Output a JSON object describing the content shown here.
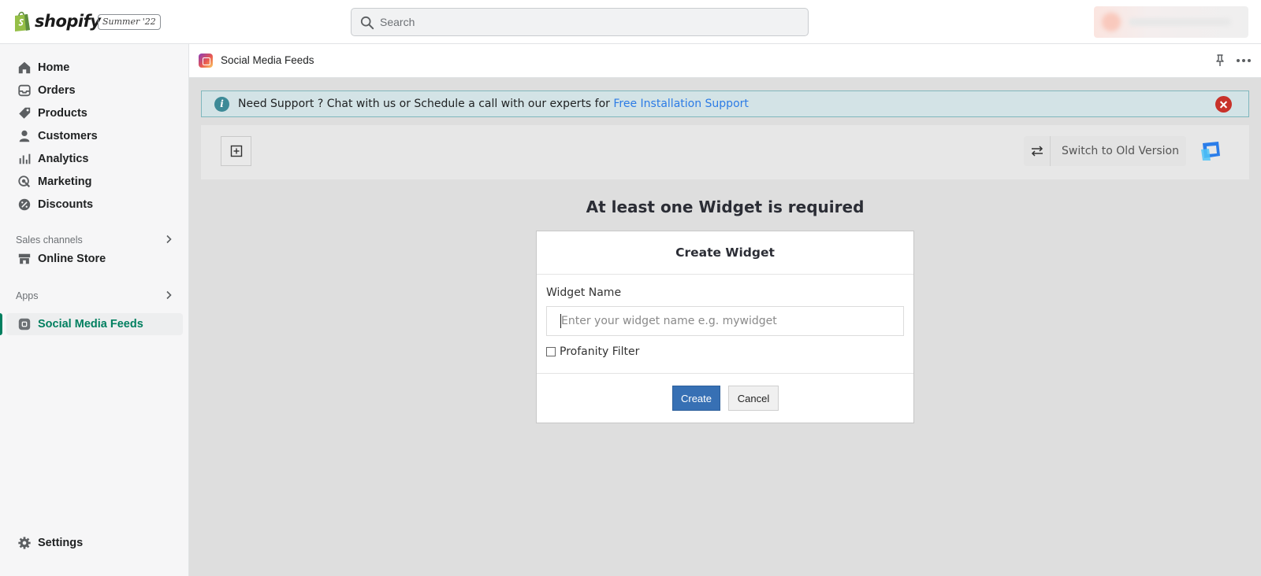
{
  "topbar": {
    "brand": "shopify",
    "edition": "Summer '22",
    "search_placeholder": "Search"
  },
  "sidebar": {
    "items": [
      {
        "label": "Home",
        "icon": "home-icon"
      },
      {
        "label": "Orders",
        "icon": "orders-icon"
      },
      {
        "label": "Products",
        "icon": "tag-icon"
      },
      {
        "label": "Customers",
        "icon": "person-icon"
      },
      {
        "label": "Analytics",
        "icon": "bar-chart-icon"
      },
      {
        "label": "Marketing",
        "icon": "target-icon"
      },
      {
        "label": "Discounts",
        "icon": "discount-icon"
      }
    ],
    "sales_channels_title": "Sales channels",
    "online_store": "Online Store",
    "apps_title": "Apps",
    "active_app": "Social Media Feeds",
    "settings": "Settings"
  },
  "app_header": {
    "title": "Social Media Feeds"
  },
  "banner": {
    "text": "Need Support ? Chat with us or Schedule a call with our experts for ",
    "link": "Free Installation Support"
  },
  "toolbar": {
    "switch_label": "Switch to Old Version"
  },
  "main": {
    "required_heading": "At least one Widget is required"
  },
  "modal": {
    "title": "Create Widget",
    "field_label": "Widget Name",
    "input_placeholder": "Enter your widget name e.g. mywidget",
    "checkbox_label": "Profanity Filter",
    "create_label": "Create",
    "cancel_label": "Cancel"
  },
  "colors": {
    "accent_green": "#007f5f",
    "primary_button": "#3770b4",
    "banner_link": "#2c7be5",
    "close_red": "#c8322a"
  }
}
